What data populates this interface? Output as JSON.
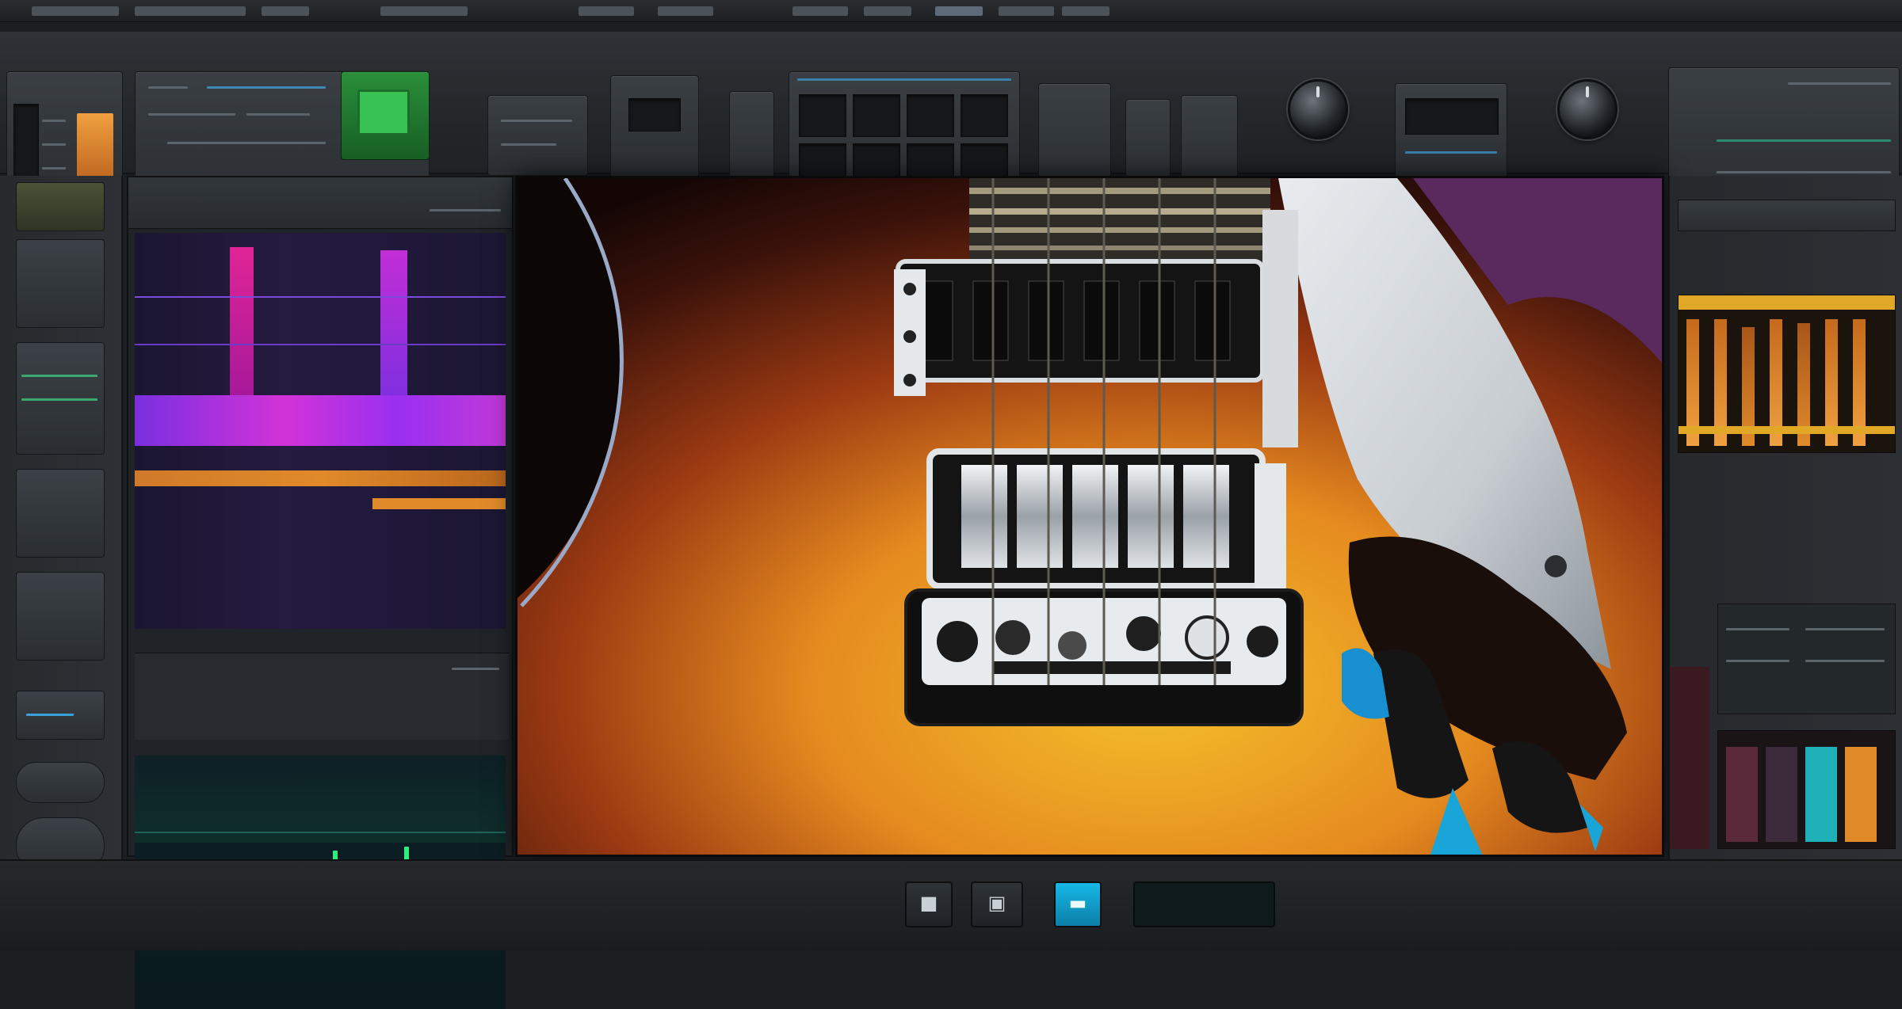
{
  "window": {
    "app_title": ""
  },
  "toolbar": {
    "knobs": [
      {
        "name": "gain",
        "label": ""
      },
      {
        "name": "output",
        "label": ""
      }
    ]
  },
  "transport": {
    "buttons": [
      {
        "name": "stop",
        "glyph": "■"
      },
      {
        "name": "record",
        "glyph": "▣"
      },
      {
        "name": "folder",
        "glyph": "▬"
      }
    ],
    "readout": ""
  },
  "colors": {
    "accent_cyan": "#16b8e6",
    "meter_orange": "#e08a2a",
    "meter_green": "#2df07a",
    "spectrum_magenta": "#d233d8",
    "spectrum_purple": "#7a2fe0"
  },
  "icons": [
    "stop-icon",
    "record-icon",
    "folder-icon",
    "knob-icon"
  ]
}
